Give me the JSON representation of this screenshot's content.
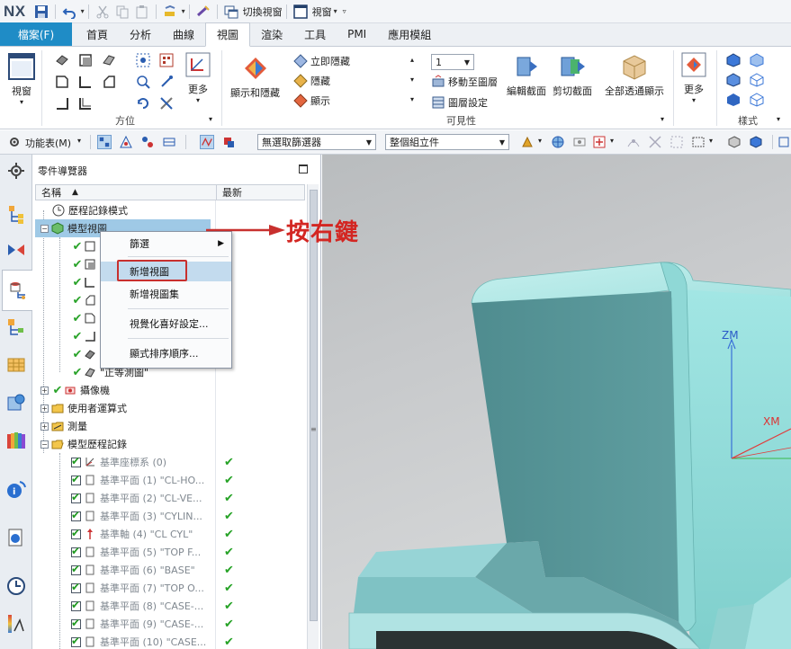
{
  "app": {
    "logo": "NX",
    "quick_access": {
      "switch_window": "切換視窗",
      "window_menu": "視窗"
    }
  },
  "tabs": [
    {
      "label": "檔案(F)"
    },
    {
      "label": "首頁"
    },
    {
      "label": "分析"
    },
    {
      "label": "曲線"
    },
    {
      "label": "視圖"
    },
    {
      "label": "渲染"
    },
    {
      "label": "工具"
    },
    {
      "label": "PMI"
    },
    {
      "label": "應用模組"
    }
  ],
  "ribbon": {
    "view_button": "視窗",
    "orient_group": "方位",
    "more1": "更多",
    "show_hide": "顯示和隱藏",
    "immediate_hide": "立即隱藏",
    "hide": "隱藏",
    "show": "顯示",
    "layer_value": "1",
    "move_to_layer": "移動至圖層",
    "layer_settings": "圖層設定",
    "visibility_group": "可見性",
    "edit_section": "編輯截面",
    "clip_section": "剪切截面",
    "full_see_through": "全部透通顯示",
    "more2": "更多",
    "style_group": "樣式"
  },
  "toolbar2": {
    "menu_label": "功能表(M)",
    "filter_select": "無選取篩選器",
    "assembly_select": "整個組立件"
  },
  "navigator": {
    "title": "零件導覽器",
    "col_name": "名稱",
    "col_latest": "最新",
    "rows": [
      {
        "label": "歷程記錄模式"
      },
      {
        "label": "模型視圖"
      },
      {
        "label": "\"正等測圖\""
      },
      {
        "label": "攝像機"
      },
      {
        "label": "使用者運算式"
      },
      {
        "label": "測量"
      },
      {
        "label": "模型歷程記錄"
      },
      {
        "label": "基準座標系 (0)"
      },
      {
        "label": "基準平面 (1) \"CL-HO..."
      },
      {
        "label": "基準平面 (2) \"CL-VE..."
      },
      {
        "label": "基準平面 (3) \"CYLIN..."
      },
      {
        "label": "基準軸 (4) \"CL CYL\""
      },
      {
        "label": "基準平面 (5) \"TOP F..."
      },
      {
        "label": "基準平面 (6) \"BASE\""
      },
      {
        "label": "基準平面 (7) \"TOP O..."
      },
      {
        "label": "基準平面 (8) \"CASE-..."
      },
      {
        "label": "基準平面 (9) \"CASE-..."
      },
      {
        "label": "基準平面 (10) \"CASE..."
      }
    ]
  },
  "context_menu": {
    "filter": "篩選",
    "new_view": "新增視圖",
    "new_view_set": "新增視圖集",
    "visual_prefs": "視覺化喜好設定...",
    "display_order": "顯式排序順序..."
  },
  "viewport": {
    "axis_z": "ZM",
    "axis_x": "XM"
  },
  "annotation": {
    "text": "按右鍵"
  }
}
